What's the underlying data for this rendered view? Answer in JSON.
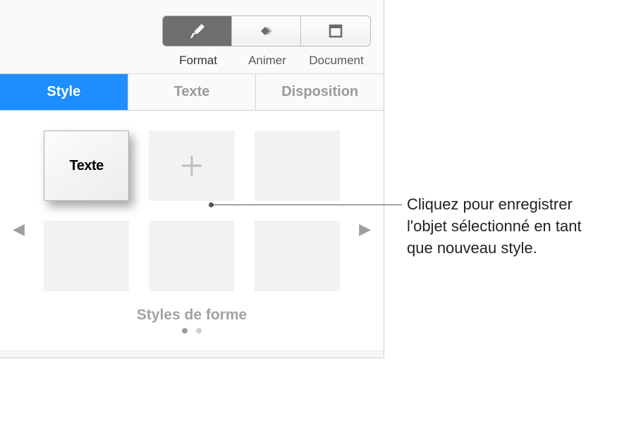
{
  "toolbar": {
    "format_label": "Format",
    "animate_label": "Animer",
    "document_label": "Document"
  },
  "tabs": {
    "style": "Style",
    "text": "Texte",
    "layout": "Disposition"
  },
  "styles": {
    "preview_text": "Texte",
    "section_title": "Styles de forme"
  },
  "callout": {
    "text": "Cliquez pour enregistrer l'objet sélectionné en tant que nouveau style."
  }
}
